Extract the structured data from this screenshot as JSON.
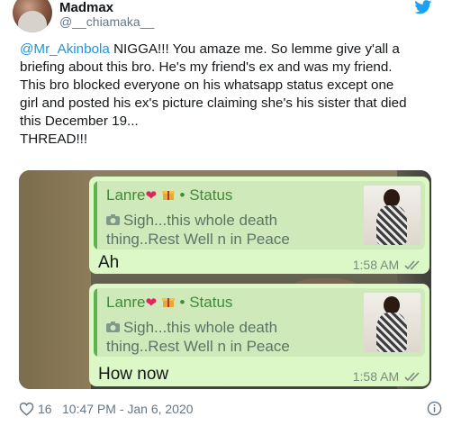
{
  "tweet": {
    "display_name": "Madmax",
    "handle": "@__chiamaka__",
    "text": {
      "mention": "@Mr_Akinbola",
      "line1_rest": " NIGGA!!! You amaze me. So lemme give y'all a",
      "line2": "briefing about this bro. He's my friend's ex and was my friend.",
      "line3": "This bro blocked everyone on his whatsapp status except one",
      "line4": "girl and posted his ex's picture claiming she's his sister that died",
      "line5": "this December 19...",
      "line6": "THREAD!!!"
    },
    "likes": "16",
    "timestamp": "10:47 PM - Jan 6, 2020"
  },
  "chat": {
    "messages": [
      {
        "quote_sender": "Lanre",
        "quote_label": "• Status",
        "quote_line1": "Sigh...this whole death",
        "quote_line2": "thing..Rest Well n in Peace",
        "text": "Ah",
        "time": "1:58 AM"
      },
      {
        "quote_sender": "Lanre",
        "quote_label": "• Status",
        "quote_line1": "Sigh...this whole death",
        "quote_line2": "thing..Rest Well n in Peace",
        "text": "How now",
        "time": "1:58 AM"
      }
    ]
  },
  "icons": {
    "brand": "twitter-bird-icon",
    "like": "heart-outline-icon",
    "info": "info-circle-icon",
    "heart_emoji": "red-heart-emoji",
    "camera": "camera-icon",
    "read_receipt": "double-check-icon"
  },
  "colors": {
    "twitter_blue": "#1b95e0",
    "bubble_green": "#dcf8c6",
    "quote_green": "#3f8b39",
    "heart_red": "#e0245e"
  }
}
